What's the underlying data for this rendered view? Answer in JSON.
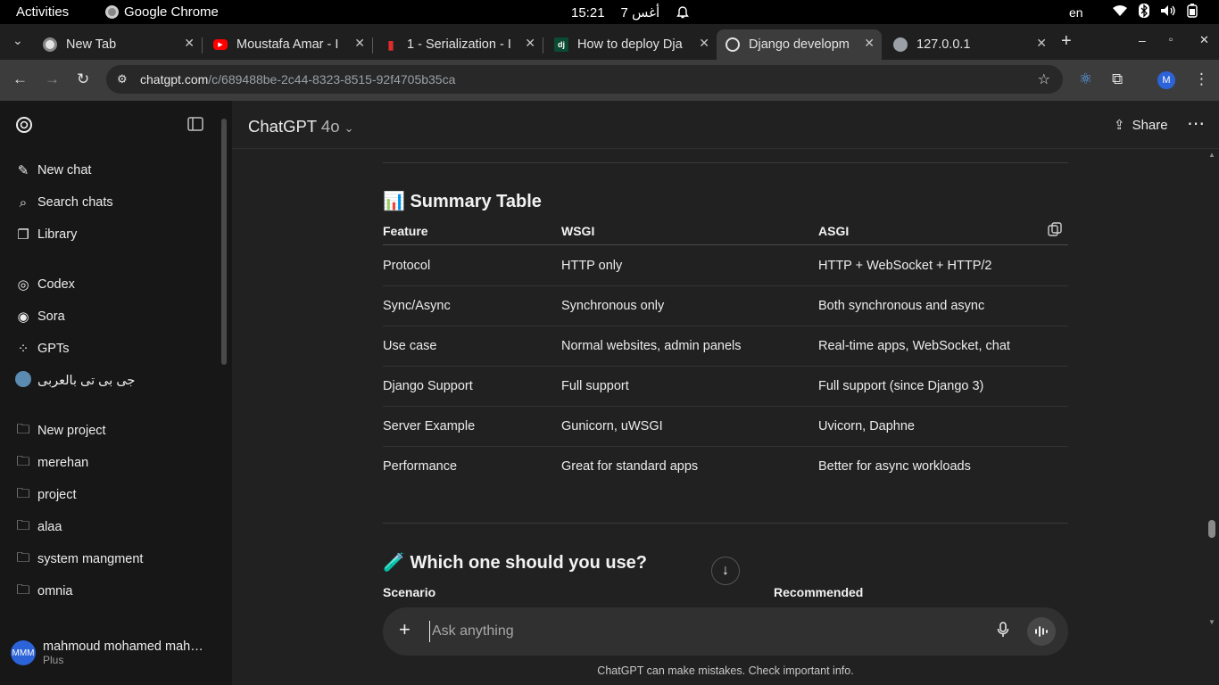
{
  "system_bar": {
    "activities": "Activities",
    "app_name": "Google Chrome",
    "date": "أغس 7",
    "time": "15:21",
    "language": "en"
  },
  "tabs": [
    {
      "title": "New Tab",
      "favicon": "chrome-icon"
    },
    {
      "title": "Moustafa Amar - I",
      "favicon": "youtube-icon"
    },
    {
      "title": "1 - Serialization - I",
      "favicon": "bookmark-icon"
    },
    {
      "title": "How to deploy Dja",
      "favicon": "django-icon"
    },
    {
      "title": "Django developm",
      "favicon": "chatgpt-icon"
    },
    {
      "title": "127.0.0.1",
      "favicon": "globe-icon"
    }
  ],
  "address_bar": {
    "domain": "chatgpt.com",
    "path": "/c/689488be-2c44-8323-8515-92f4705b35ca"
  },
  "sidebar": {
    "top_items": [
      {
        "label": "New chat",
        "icon": "edit-icon"
      },
      {
        "label": "Search chats",
        "icon": "search-icon"
      },
      {
        "label": "Library",
        "icon": "library-icon"
      }
    ],
    "app_items": [
      {
        "label": "Codex",
        "icon": "codex-icon"
      },
      {
        "label": "Sora",
        "icon": "sora-icon"
      },
      {
        "label": "GPTs",
        "icon": "grid-icon"
      },
      {
        "label": "جى بى تى بالعربى",
        "icon": "gpt-avatar-icon"
      }
    ],
    "project_items": [
      {
        "label": "New project",
        "icon": "new-folder-icon"
      },
      {
        "label": "merehan",
        "icon": "folder-icon"
      },
      {
        "label": "project",
        "icon": "folder-icon"
      },
      {
        "label": "alaa",
        "icon": "folder-icon"
      },
      {
        "label": "system mangment",
        "icon": "folder-icon"
      },
      {
        "label": "omnia",
        "icon": "folder-icon"
      }
    ],
    "user": {
      "initials": "MMM",
      "name": "mahmoud mohamed mah…",
      "plan": "Plus"
    }
  },
  "header": {
    "model": "ChatGPT",
    "version": "4o",
    "share_label": "Share"
  },
  "summary": {
    "title": "Summary Table",
    "title_emoji": "📊",
    "columns": [
      "Feature",
      "WSGI",
      "ASGI"
    ],
    "rows": [
      [
        "Protocol",
        "HTTP only",
        "HTTP + WebSocket + HTTP/2"
      ],
      [
        "Sync/Async",
        "Synchronous only",
        "Both synchronous and async"
      ],
      [
        "Use case",
        "Normal websites, admin panels",
        "Real-time apps, WebSocket, chat"
      ],
      [
        "Django Support",
        "Full support",
        "Full support (since Django 3)"
      ],
      [
        "Server Example",
        "Gunicorn, uWSGI",
        "Uvicorn, Daphne"
      ],
      [
        "Performance",
        "Great for standard apps",
        "Better for async workloads"
      ]
    ]
  },
  "which": {
    "title": "Which one should you use?",
    "title_emoji": "🧪",
    "columns": [
      "Scenario",
      "Recommended"
    ]
  },
  "composer": {
    "placeholder": "Ask anything"
  },
  "disclaimer": "ChatGPT can make mistakes. Check important info."
}
